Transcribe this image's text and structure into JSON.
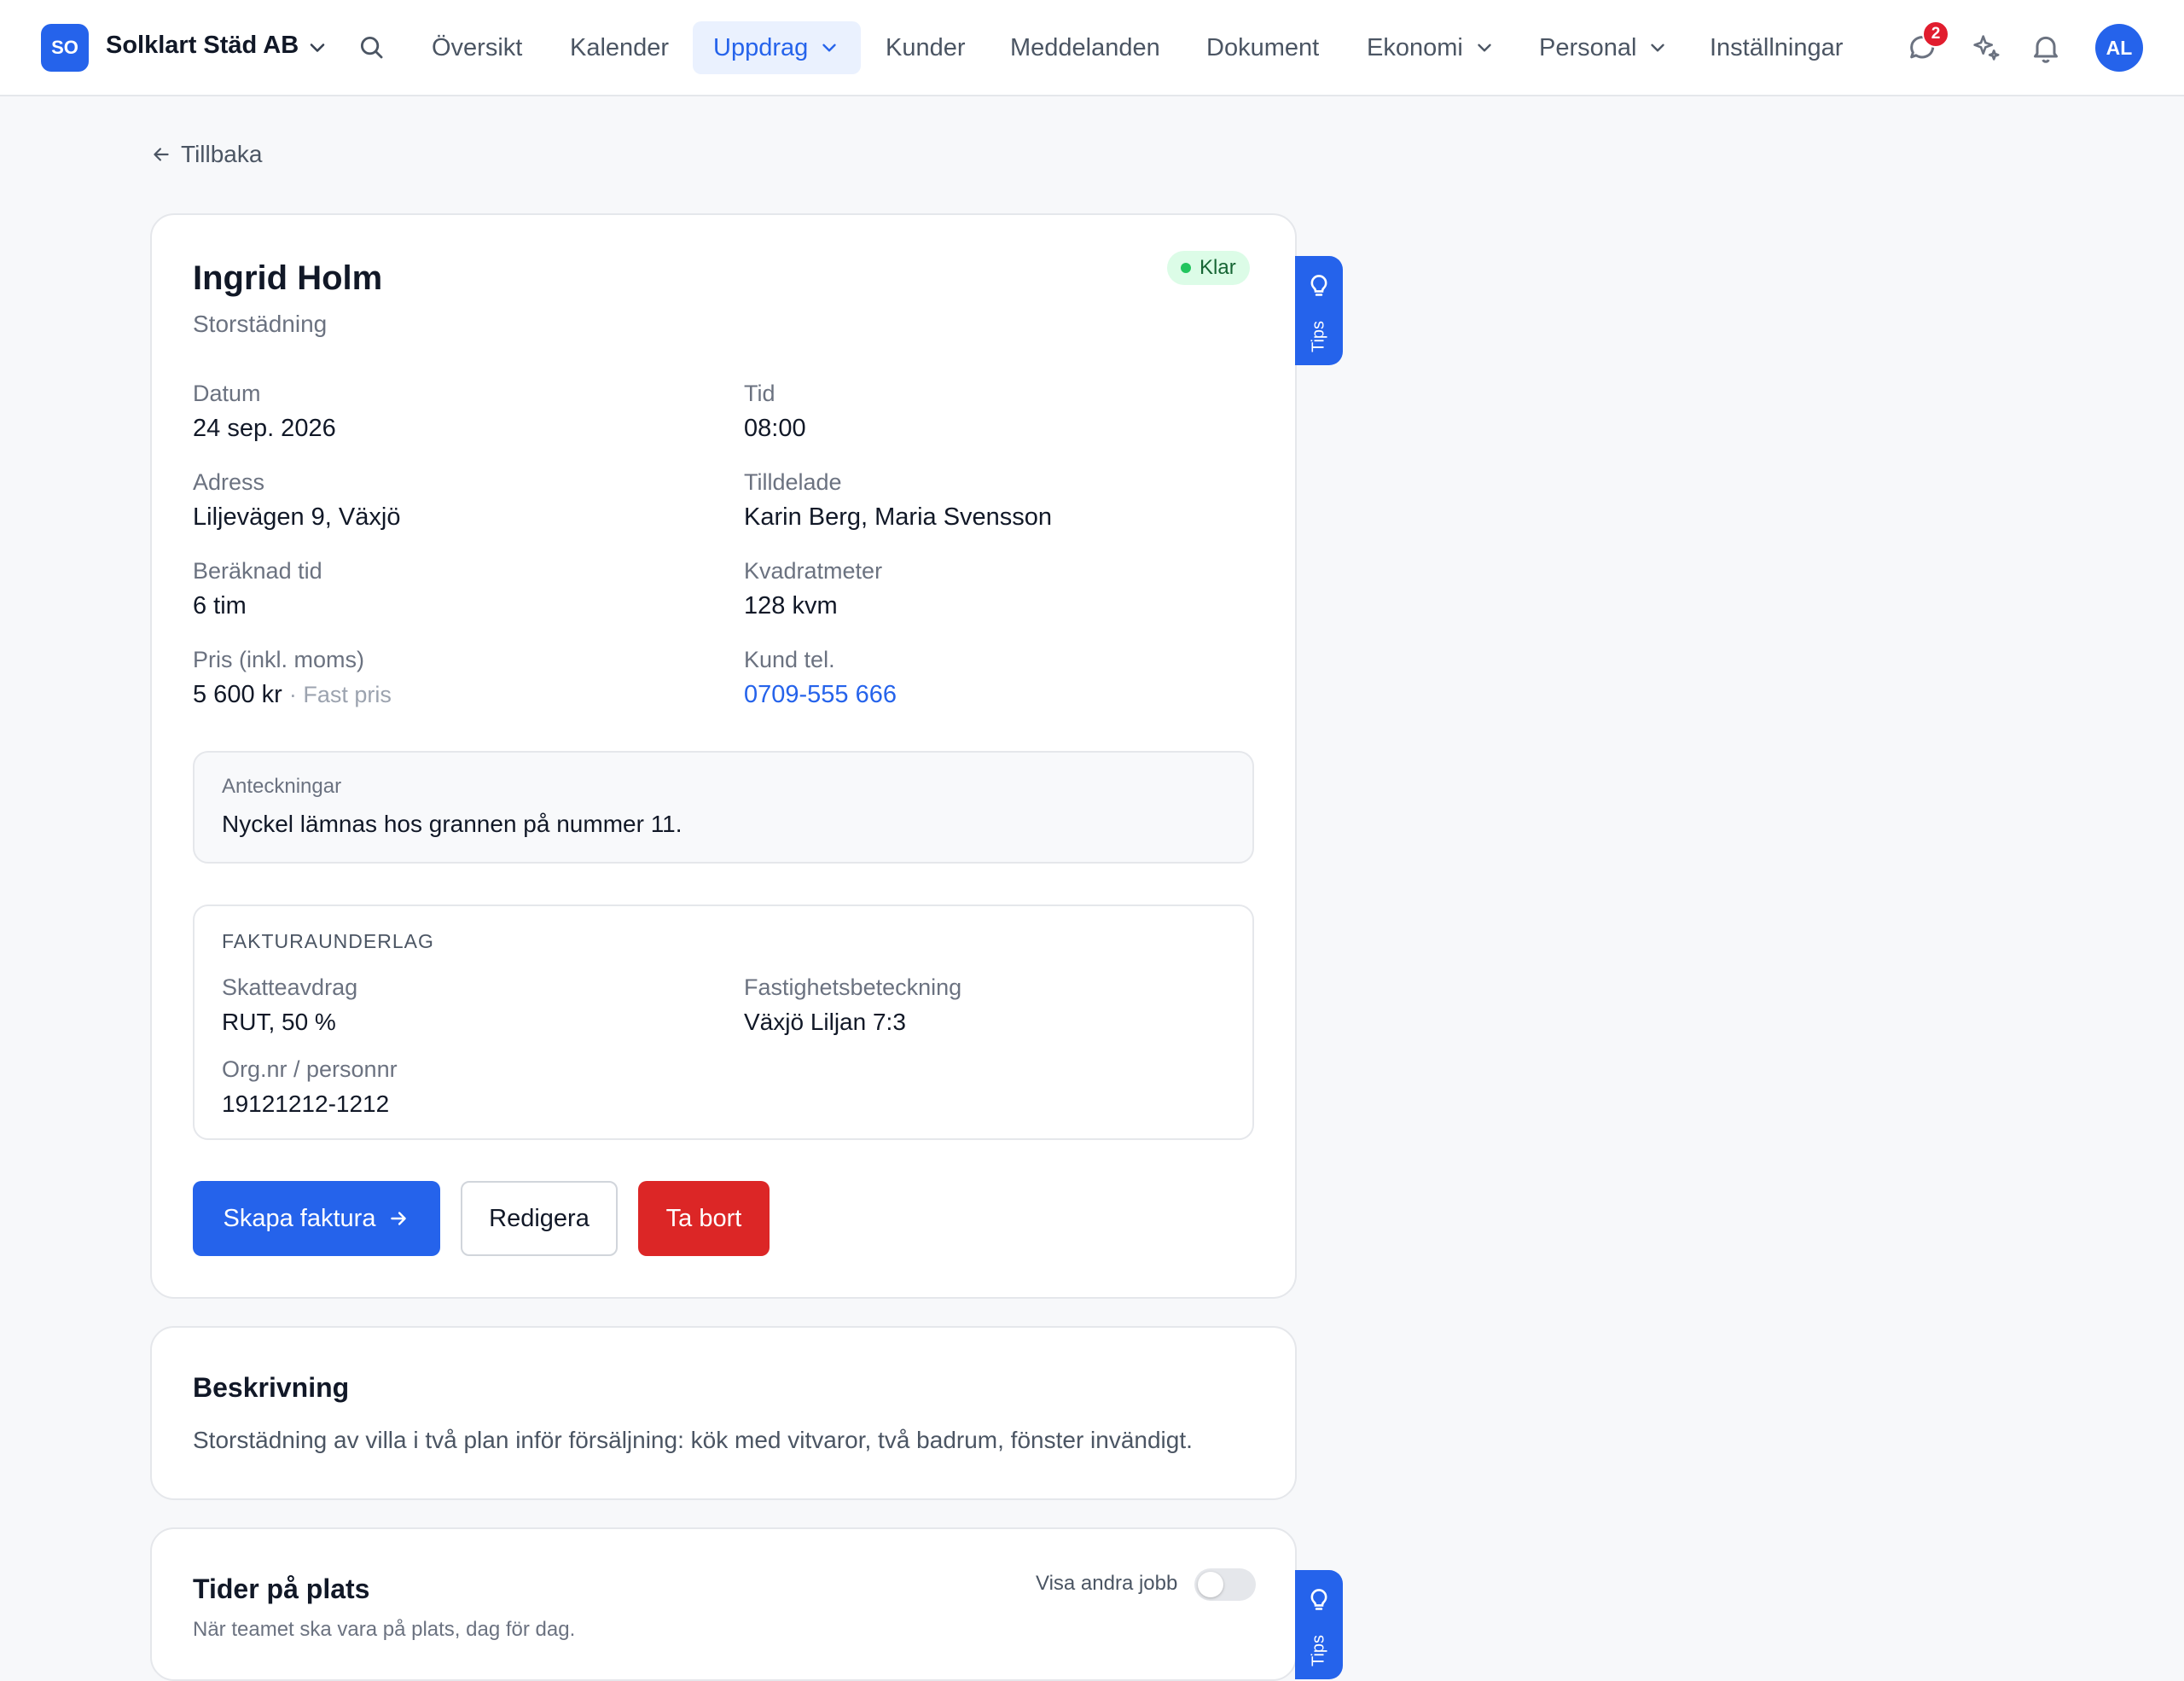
{
  "header": {
    "logo_initials": "SO",
    "company": "Solklart Städ AB",
    "nav": [
      {
        "label": "Översikt"
      },
      {
        "label": "Kalender"
      },
      {
        "label": "Uppdrag"
      },
      {
        "label": "Kunder"
      },
      {
        "label": "Meddelanden"
      },
      {
        "label": "Dokument"
      },
      {
        "label": "Ekonomi"
      },
      {
        "label": "Personal"
      },
      {
        "label": "Inställningar"
      }
    ],
    "active_nav": "Uppdrag",
    "messages_badge": "2",
    "avatar_initials": "AL"
  },
  "back_label": "Tillbaka",
  "job": {
    "customer": "Ingrid Holm",
    "service": "Storstädning",
    "status": "Klar",
    "fields": {
      "date_label": "Datum",
      "date": "24 sep. 2026",
      "time_label": "Tid",
      "time": "08:00",
      "address_label": "Adress",
      "address": "Liljevägen 9, Växjö",
      "assigned_label": "Tilldelade",
      "assigned": "Karin Berg, Maria Svensson",
      "duration_label": "Beräknad tid",
      "duration": "6 tim",
      "area_label": "Kvadratmeter",
      "area": "128 kvm",
      "price_label": "Pris (inkl. moms)",
      "price": "5 600 kr",
      "price_note": "· Fast pris",
      "phone_label": "Kund tel.",
      "phone": "0709-555 666"
    },
    "notes": {
      "label": "Anteckningar",
      "text": "Nyckel lämnas hos grannen på nummer 11."
    },
    "invoice": {
      "heading": "FAKTURAUNDERLAG",
      "tax_label": "Skatteavdrag",
      "tax": "RUT, 50 %",
      "property_label": "Fastighetsbeteckning",
      "property": "Växjö Liljan 7:3",
      "orgnr_label": "Org.nr / personnr",
      "orgnr": "19121212-1212"
    },
    "actions": {
      "create_invoice": "Skapa faktura",
      "edit": "Redigera",
      "delete": "Ta bort"
    }
  },
  "description": {
    "title": "Beskrivning",
    "text": "Storstädning av villa i två plan inför försäljning: kök med vitvaror, två badrum, fönster invändigt."
  },
  "onsite": {
    "title": "Tider på plats",
    "subtitle": "När teamet ska vara på plats, dag för dag.",
    "toggle_label": "Visa andra jobb",
    "toggle_on": false
  },
  "tips": {
    "label": "Tips"
  },
  "colors": {
    "accent": "#2563eb",
    "danger": "#dc2626",
    "success": "#22c55e"
  }
}
